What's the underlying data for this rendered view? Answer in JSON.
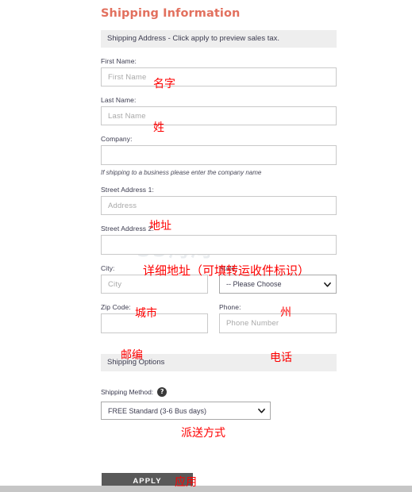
{
  "page": {
    "title": "Shipping Information",
    "section_address_bar": "Shipping Address - Click apply to preview sales tax.",
    "section_options_bar": "Shipping Options",
    "watermark": "55海淘"
  },
  "colors": {
    "title": "#e2705e",
    "annotation": "#fe0000",
    "section_bar_bg": "#eeeeee",
    "apply_bg": "#595959"
  },
  "fields": {
    "first_name": {
      "label": "First Name:",
      "placeholder": "First Name",
      "value": ""
    },
    "last_name": {
      "label": "Last Name:",
      "placeholder": "Last Name",
      "value": ""
    },
    "company": {
      "label": "Company:",
      "placeholder": "",
      "value": "",
      "hint": "If shipping to a business please enter the company name"
    },
    "street1": {
      "label": "Street Address 1:",
      "placeholder": "Address",
      "value": ""
    },
    "street2": {
      "label": "Street Address 2:",
      "placeholder": "",
      "value": ""
    },
    "city": {
      "label": "City:",
      "placeholder": "City",
      "value": ""
    },
    "state": {
      "label": "State:",
      "selected": "-- Please Choose",
      "value": ""
    },
    "zip": {
      "label": "Zip Code:",
      "placeholder": "",
      "value": ""
    },
    "phone": {
      "label": "Phone:",
      "placeholder": "Phone Number",
      "value": ""
    }
  },
  "shipping_method": {
    "label": "Shipping Method:",
    "help_icon": "?",
    "selected": "FREE Standard (3-6 Bus days)"
  },
  "apply_button": {
    "label": "APPLY"
  },
  "icons": {
    "caret_down": "chevron-down-icon",
    "help": "question-mark-icon"
  },
  "annotations": {
    "first_name": "名字",
    "last_name": "姓",
    "street1": "地址",
    "street2": "详细地址（可填转运收件标识）",
    "city": "城市",
    "state": "州",
    "zip": "邮编",
    "phone": "电话",
    "shipping_method": "派送方式",
    "apply": "应用"
  }
}
